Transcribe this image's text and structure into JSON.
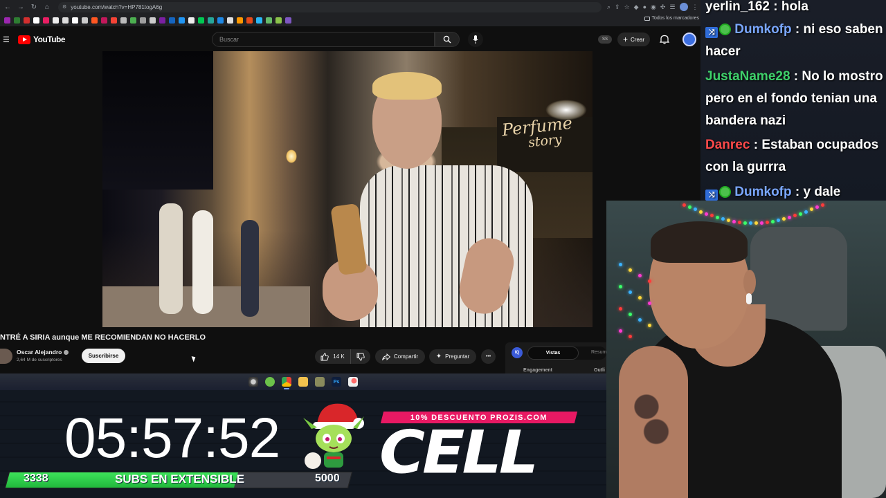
{
  "browser": {
    "url": "youtube.com/watch?v=HP781togA6g",
    "bookmarks_folder": "Todos los marcadores"
  },
  "youtube": {
    "logo_text": "YouTube",
    "search_placeholder": "Buscar",
    "ss_badge": "SS",
    "create_label": "Crear",
    "video_title": "NTRÉ A SIRIA aunque ME RECOMIENDAN NO HACERLO",
    "overlay_text_line1": "Perfume",
    "overlay_text_line2": "story",
    "channel_name": "Oscar Alejandro",
    "subscribers": "2,64 M de suscriptores",
    "subscribe_label": "Suscribirse",
    "likes": "14 K",
    "share_label": "Compartir",
    "ask_label": "Preguntar",
    "more_label": "•••",
    "panel": {
      "iq_label": "IQ",
      "tab_active": "Vistas",
      "tab_other": "Resum",
      "engagement_label": "Engagement",
      "outliers_label": "Outli"
    }
  },
  "overlay": {
    "timer": "05:57:52",
    "sub_start": "3338",
    "sub_label": "SUBS EN EXTENSIBLE",
    "sub_goal": "5000",
    "sub_progress_fraction": 0.668,
    "promo_text": "10% DESCUENTO PROZIS.COM",
    "brand": "CELL"
  },
  "chat": [
    {
      "user": "yerlin_162",
      "text": "hola",
      "color": "#ffffff",
      "badges": false
    },
    {
      "user": "Dumkofp",
      "text": "ni eso saben hacer",
      "color": "#7aa7ff",
      "badges": true
    },
    {
      "user": "JustaName28",
      "text": "No lo mostro pero en el fondo tenian una bandera nazi",
      "color": "#3ecf6a",
      "badges": false
    },
    {
      "user": "Danrec",
      "text": "Estaban ocupados con la gurrra",
      "color": "#ff4a4a",
      "badges": false
    },
    {
      "user": "Dumkofp",
      "text": "y dale",
      "color": "#7aa7ff",
      "badges": true
    }
  ]
}
